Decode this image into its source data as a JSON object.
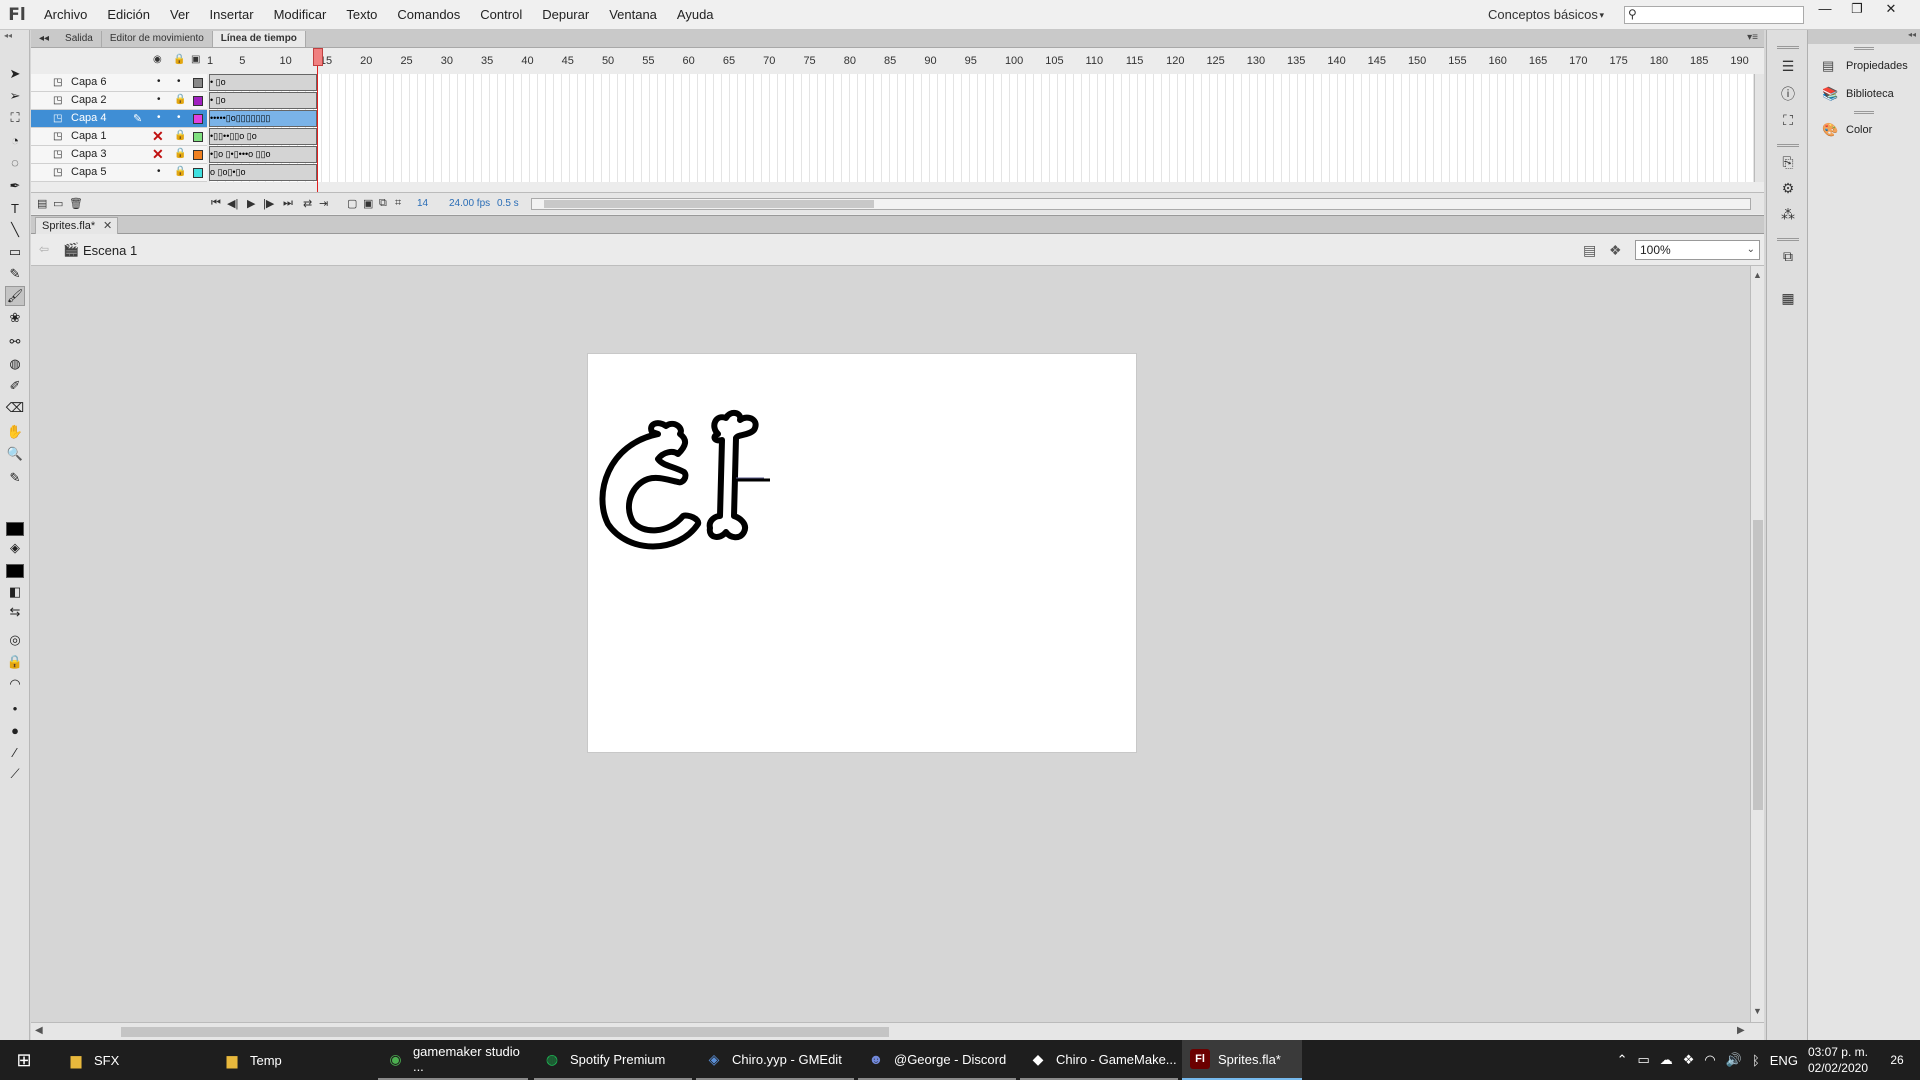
{
  "app": {
    "logo": "Fl",
    "menu": [
      "Archivo",
      "Edición",
      "Ver",
      "Insertar",
      "Modificar",
      "Texto",
      "Comandos",
      "Control",
      "Depurar",
      "Ventana",
      "Ayuda"
    ],
    "workspace": "Conceptos básicos",
    "search_placeholder": ""
  },
  "panel_tabs": [
    "Salida",
    "Editor de movimiento",
    "Línea de tiempo"
  ],
  "timeline": {
    "layers": [
      {
        "name": "Capa 6",
        "color": "#888888",
        "hidden": false,
        "selected": false,
        "frames": "• ▯o"
      },
      {
        "name": "Capa 2",
        "color": "#a020c0",
        "hidden": false,
        "selected": false,
        "frames": "•   ▯o"
      },
      {
        "name": "Capa 4",
        "color": "#e040e0",
        "hidden": false,
        "selected": true,
        "frames": "•••••▯o▯▯▯▯▯▯▯"
      },
      {
        "name": "Capa 1",
        "color": "#80e080",
        "hidden": true,
        "selected": false,
        "frames": "•▯▯••▯▯o  ▯o"
      },
      {
        "name": "Capa 3",
        "color": "#f08020",
        "hidden": true,
        "selected": false,
        "frames": "•▯o ▯•▯•••o ▯▯o"
      },
      {
        "name": "Capa 5",
        "color": "#40e0e0",
        "hidden": false,
        "selected": false,
        "frames": "o ▯o▯•▯o"
      }
    ],
    "ruler_labels": [
      "1",
      "5",
      "10",
      "15",
      "20",
      "25",
      "30",
      "35",
      "40",
      "45",
      "50",
      "55",
      "60",
      "65",
      "70",
      "75",
      "80",
      "85",
      "90",
      "95",
      "100",
      "105",
      "110",
      "115",
      "120",
      "125",
      "130",
      "135",
      "140",
      "145",
      "150",
      "155",
      "160",
      "165",
      "170",
      "175",
      "180",
      "185",
      "190"
    ],
    "current_frame": "14",
    "fps": "24.00 fps",
    "time": "0.5 s"
  },
  "document": {
    "tab": "Sprites.fla*",
    "scene": "Escena 1",
    "zoom": "100%"
  },
  "side_panel": {
    "items": [
      "Propiedades",
      "Biblioteca",
      "Color"
    ]
  },
  "taskbar": {
    "items": [
      {
        "label": "SFX",
        "icon": "folder-icon",
        "state": "none"
      },
      {
        "label": "Temp",
        "icon": "folder-icon",
        "state": "none"
      },
      {
        "label": "gamemaker studio ...",
        "icon": "chrome-icon",
        "state": "open"
      },
      {
        "label": "Spotify Premium",
        "icon": "spotify-icon",
        "state": "open"
      },
      {
        "label": "Chiro.yyp - GMEdit",
        "icon": "gmedit-icon",
        "state": "open"
      },
      {
        "label": "@George - Discord",
        "icon": "discord-icon",
        "state": "open"
      },
      {
        "label": "Chiro - GameMake...",
        "icon": "gamemaker-icon",
        "state": "open"
      },
      {
        "label": "Sprites.fla*",
        "icon": "flash-icon",
        "state": "active"
      }
    ],
    "language": "ENG",
    "time": "03:07 p. m.",
    "date": "02/02/2020",
    "notifications": "26"
  }
}
